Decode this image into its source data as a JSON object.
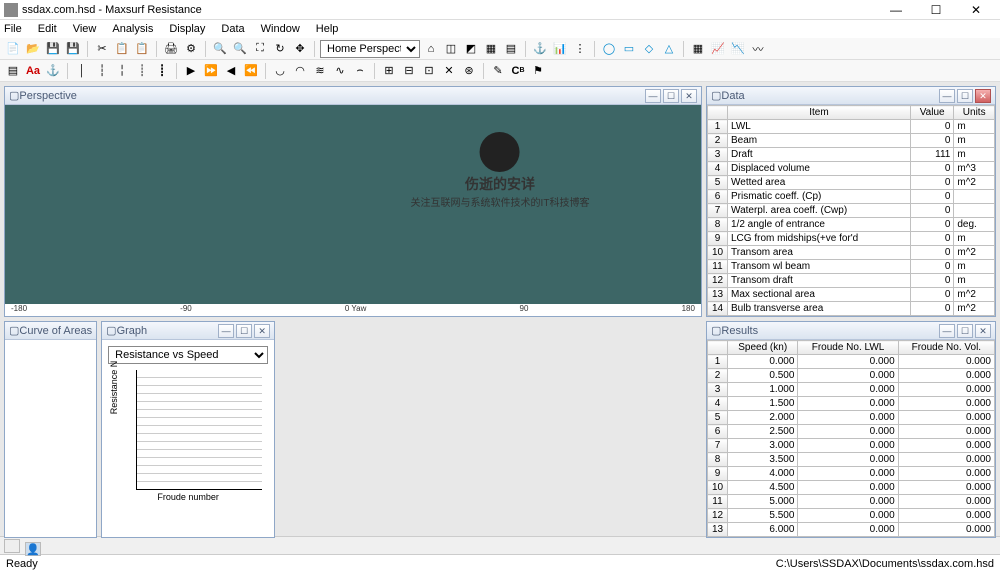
{
  "window": {
    "title": "ssdax.com.hsd - Maxsurf Resistance"
  },
  "menu": [
    "File",
    "Edit",
    "View",
    "Analysis",
    "Display",
    "Data",
    "Window",
    "Help"
  ],
  "toolbar2": {
    "perspective": "Home Perspective"
  },
  "watermark": {
    "line1": "伤逝的安详",
    "line2": "关注互联网与系统软件技术的IT科技博客"
  },
  "panels": {
    "perspective": {
      "title": "Perspective",
      "axis": [
        "-180",
        "-90",
        "0 Yaw",
        "90",
        "180"
      ]
    },
    "data": {
      "title": "Data",
      "headers": [
        "",
        "Item",
        "Value",
        "Units"
      ],
      "rows": [
        [
          "1",
          "LWL",
          "0",
          "m"
        ],
        [
          "2",
          "Beam",
          "0",
          "m"
        ],
        [
          "3",
          "Draft",
          "111",
          "m"
        ],
        [
          "4",
          "Displaced volume",
          "0",
          "m^3"
        ],
        [
          "5",
          "Wetted area",
          "0",
          "m^2"
        ],
        [
          "6",
          "Prismatic coeff. (Cp)",
          "0",
          ""
        ],
        [
          "7",
          "Waterpl. area coeff. (Cwp)",
          "0",
          ""
        ],
        [
          "8",
          "1/2 angle of entrance",
          "0",
          "deg."
        ],
        [
          "9",
          "LCG from midships(+ve for'd",
          "0",
          "m"
        ],
        [
          "10",
          "Transom area",
          "0",
          "m^2"
        ],
        [
          "11",
          "Transom wl beam",
          "0",
          "m"
        ],
        [
          "12",
          "Transom draft",
          "0",
          "m"
        ],
        [
          "13",
          "Max sectional area",
          "0",
          "m^2"
        ],
        [
          "14",
          "Bulb transverse area",
          "0",
          "m^2"
        ]
      ]
    },
    "curve": {
      "title": "Curve of Areas"
    },
    "graph": {
      "title": "Graph",
      "selector": "Resistance vs Speed",
      "ylabel": "Resistance N",
      "xlabel": "Froude number"
    },
    "results": {
      "title": "Results",
      "headers": [
        "",
        "Speed (kn)",
        "Froude No. LWL",
        "Froude No. Vol."
      ],
      "rows": [
        [
          "1",
          "0.000",
          "0.000",
          "0.000"
        ],
        [
          "2",
          "0.500",
          "0.000",
          "0.000"
        ],
        [
          "3",
          "1.000",
          "0.000",
          "0.000"
        ],
        [
          "4",
          "1.500",
          "0.000",
          "0.000"
        ],
        [
          "5",
          "2.000",
          "0.000",
          "0.000"
        ],
        [
          "6",
          "2.500",
          "0.000",
          "0.000"
        ],
        [
          "7",
          "3.000",
          "0.000",
          "0.000"
        ],
        [
          "8",
          "3.500",
          "0.000",
          "0.000"
        ],
        [
          "9",
          "4.000",
          "0.000",
          "0.000"
        ],
        [
          "10",
          "4.500",
          "0.000",
          "0.000"
        ],
        [
          "11",
          "5.000",
          "0.000",
          "0.000"
        ],
        [
          "12",
          "5.500",
          "0.000",
          "0.000"
        ],
        [
          "13",
          "6.000",
          "0.000",
          "0.000"
        ]
      ]
    }
  },
  "chart_data": {
    "type": "line",
    "title": "Resistance vs Speed",
    "xlabel": "Froude number",
    "ylabel": "Resistance N",
    "x": [],
    "y": [],
    "ylim": [
      0,
      1
    ]
  },
  "status": {
    "left": "Ready",
    "right": "C:\\Users\\SSDAX\\Documents\\ssdax.com.hsd"
  },
  "tabbar": {
    "btns": 2
  }
}
